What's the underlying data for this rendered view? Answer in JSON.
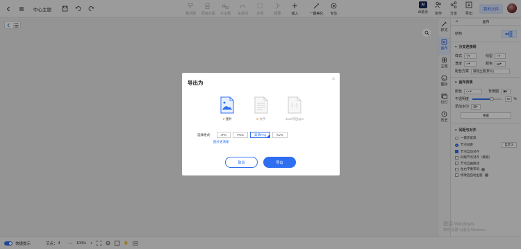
{
  "header": {
    "title": "中心主题",
    "tools": [
      {
        "label": "格式刷",
        "icon": "format-brush-icon",
        "active": false
      },
      {
        "label": "同级主题",
        "icon": "sibling-topic-icon",
        "active": false
      },
      {
        "label": "子主题",
        "icon": "subtopic-icon",
        "active": false
      },
      {
        "label": "关系线",
        "icon": "relation-line-icon",
        "active": false
      },
      {
        "label": "外框",
        "icon": "boundary-icon",
        "active": false
      },
      {
        "label": "概要",
        "icon": "summary-icon",
        "active": false
      },
      {
        "label": "插入",
        "icon": "insert-icon",
        "active": true
      },
      {
        "label": "一键美化",
        "icon": "beautify-icon",
        "active": true
      },
      {
        "label": "专注",
        "icon": "focus-icon",
        "active": true
      }
    ],
    "right_tools": [
      {
        "label": "AI助手",
        "icon": "ai-icon"
      },
      {
        "label": "协作",
        "icon": "collab-icon"
      },
      {
        "label": "分享",
        "icon": "share-icon"
      },
      {
        "label": "导出",
        "icon": "export-icon"
      }
    ],
    "my_files": "我的文件"
  },
  "sidestrip": [
    {
      "label": "样式",
      "icon": "style-icon",
      "active": false
    },
    {
      "label": "画布",
      "icon": "canvas-icon",
      "active": true
    },
    {
      "label": "主题",
      "icon": "theme-icon",
      "active": false
    },
    {
      "label": "图标",
      "icon": "emoji-icon",
      "active": false
    },
    {
      "label": "幻灯",
      "icon": "slides-icon",
      "active": false
    },
    {
      "label": "历史",
      "icon": "history-icon",
      "active": false
    }
  ],
  "panel": {
    "title": "画布",
    "structure_label": "结构",
    "branch_section": "分支连接线",
    "style_label": "样式",
    "line_label": "线型",
    "width_label": "宽度",
    "color_label": "颜色",
    "color_scheme_label": "配色方案",
    "color_scheme_value": "跟随主题(默认)",
    "bg_section": "画布背景",
    "bg_color_label": "颜色",
    "bg_image_label": "背景图",
    "opacity_label": "不透明度",
    "opacity_value": "60",
    "opacity_unit": "%",
    "watermark_label": "添加水印",
    "reset_label": "重置",
    "layout_section": "间距与对齐",
    "options": [
      {
        "label": "一键变紧凑",
        "type": "radio",
        "checked": false
      },
      {
        "label": "节点间距",
        "type": "radio",
        "checked": true,
        "extra": "自定义"
      },
      {
        "label": "节点自动对齐",
        "type": "check",
        "checked": true
      },
      {
        "label": "同级节点对齐（横宽）",
        "type": "check",
        "checked": false
      },
      {
        "label": "节点自由拖动",
        "type": "check",
        "checked": false
      },
      {
        "label": "左右平衡布局",
        "type": "check",
        "checked": false
      },
      {
        "label": "修改后自动主题",
        "type": "check",
        "checked": false
      }
    ]
  },
  "bottom": {
    "shortcut_label": "快捷提示",
    "nodes_label": "节点：",
    "nodes_value": "4",
    "zoom": "100%"
  },
  "watermark": {
    "line1": "激活 Windows",
    "line2": "转到“设置”以激活 Windows。"
  },
  "dialog": {
    "title": "导出为",
    "formats": [
      {
        "label": "图片",
        "icon": "image-file-icon",
        "selected": true,
        "badge": true
      },
      {
        "label": "文件",
        "icon": "document-file-icon",
        "selected": false,
        "badge": true
      },
      {
        "label": "Json导出/gm",
        "icon": "json-file-icon",
        "selected": false,
        "badge": false
      }
    ],
    "type_label": "选择格式：",
    "types": [
      {
        "label": "JPG",
        "selected": false
      },
      {
        "label": "PNG",
        "selected": false
      },
      {
        "label": "高清Png",
        "selected": true
      },
      {
        "label": "SVG",
        "selected": false
      }
    ],
    "bg_link": "图片更清晰",
    "cancel": "取消",
    "export": "导出"
  }
}
